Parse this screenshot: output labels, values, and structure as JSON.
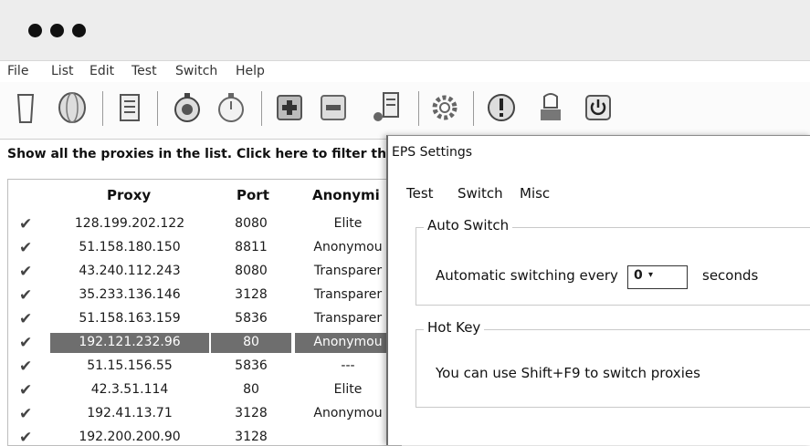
{
  "window": {
    "dots": [
      "dot-1",
      "dot-2",
      "dot-3"
    ]
  },
  "menu": [
    "File",
    "List",
    "Edit",
    "Test",
    "Switch",
    "Help"
  ],
  "toolbar": {
    "icons": [
      "clipboard-icon",
      "globe-icon",
      "list-icon",
      "stopwatch-add-icon",
      "stopwatch-icon",
      "add-proxy-icon",
      "remove-proxy-icon",
      "database-user-icon",
      "settings-gear-icon",
      "alert-icon",
      "clear-icon",
      "power-icon"
    ]
  },
  "hint": "Show all the proxies in the list. Click here to filter the",
  "table": {
    "columns": [
      "Proxy",
      "Port",
      "Anonymi"
    ],
    "rows": [
      {
        "proxy": "128.199.202.122",
        "port": "8080",
        "anon": "Elite"
      },
      {
        "proxy": "51.158.180.150",
        "port": "8811",
        "anon": "Anonymou"
      },
      {
        "proxy": "43.240.112.243",
        "port": "8080",
        "anon": "Transparer"
      },
      {
        "proxy": "35.233.136.146",
        "port": "3128",
        "anon": "Transparer"
      },
      {
        "proxy": "51.158.163.159",
        "port": "5836",
        "anon": "Transparer"
      },
      {
        "proxy": "192.121.232.96",
        "port": "80",
        "anon": "Anonymou",
        "selected": true
      },
      {
        "proxy": "51.15.156.55",
        "port": "5836",
        "anon": "---"
      },
      {
        "proxy": "42.3.51.114",
        "port": "80",
        "anon": "Elite"
      },
      {
        "proxy": "192.41.13.71",
        "port": "3128",
        "anon": "Anonymou"
      },
      {
        "proxy": "192.200.200.90",
        "port": "3128",
        "anon": ""
      }
    ]
  },
  "dialog": {
    "title": "EPS Settings",
    "tabs": [
      "Test",
      "Switch",
      "Misc"
    ],
    "auto_switch": {
      "title": "Auto Switch",
      "label": "Automatic switching every",
      "value": "0",
      "unit": "seconds"
    },
    "hot_key": {
      "title": "Hot Key",
      "text": "You can use Shift+F9 to switch proxies"
    }
  }
}
